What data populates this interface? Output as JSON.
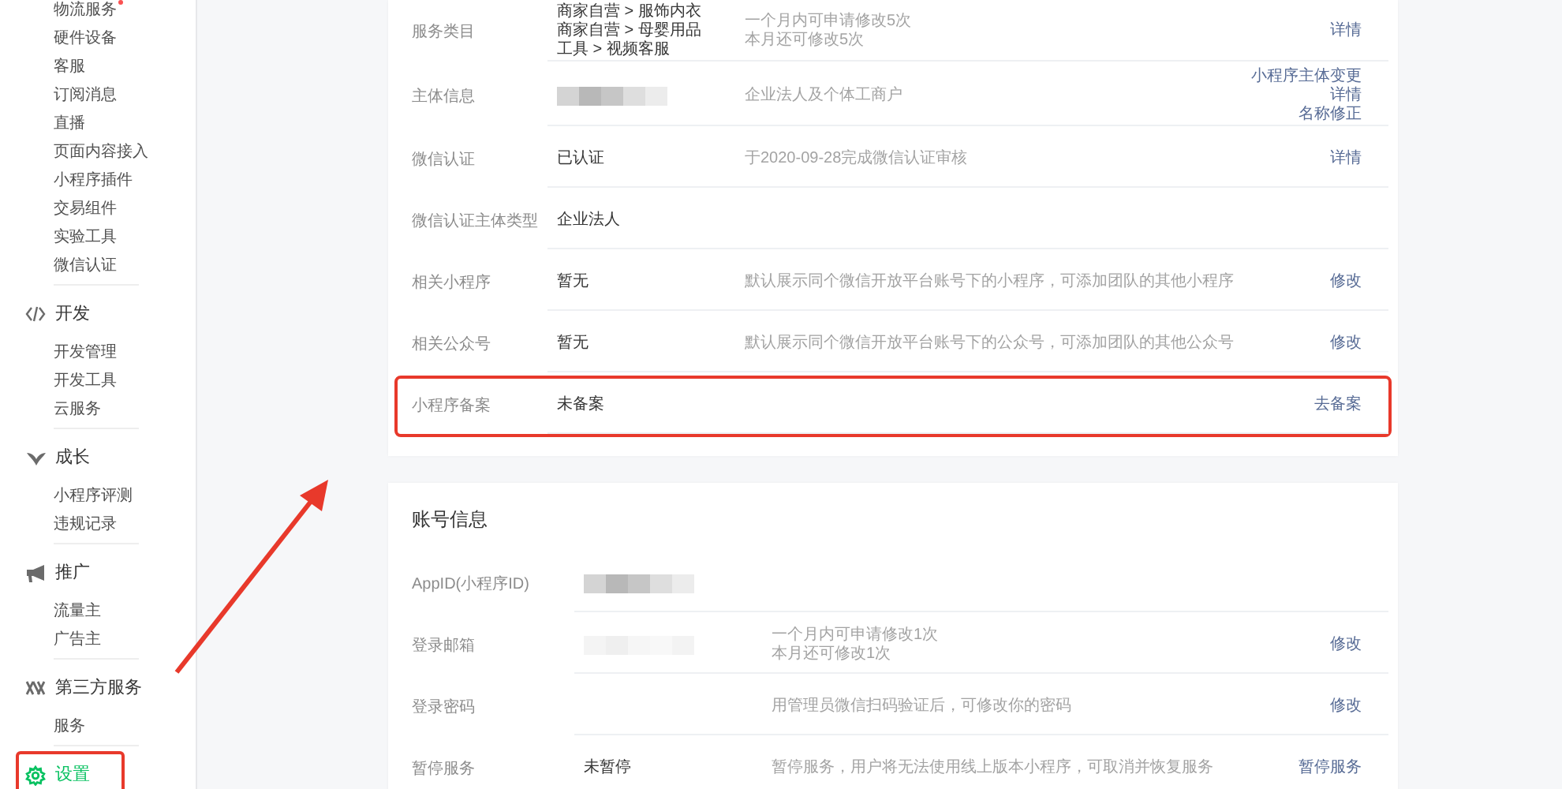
{
  "sidebar": {
    "sections": [
      {
        "items": [
          {
            "label": "物流服务",
            "dot": true,
            "selected": false
          },
          {
            "label": "硬件设备",
            "dot": false,
            "selected": false
          },
          {
            "label": "客服",
            "dot": false,
            "selected": false
          },
          {
            "label": "订阅消息",
            "dot": false,
            "selected": false
          },
          {
            "label": "直播",
            "dot": false,
            "selected": false
          },
          {
            "label": "页面内容接入",
            "dot": false,
            "selected": false
          },
          {
            "label": "小程序插件",
            "dot": false,
            "selected": false
          },
          {
            "label": "交易组件",
            "dot": false,
            "selected": false
          },
          {
            "label": "实验工具",
            "dot": false,
            "selected": false
          },
          {
            "label": "微信认证",
            "dot": false,
            "selected": false
          }
        ]
      },
      {
        "title": "开发",
        "kind": "code",
        "selected": false,
        "highlighted": false,
        "items": [
          {
            "label": "开发管理",
            "dot": false,
            "selected": false
          },
          {
            "label": "开发工具",
            "dot": false,
            "selected": false
          },
          {
            "label": "云服务",
            "dot": false,
            "selected": false
          }
        ]
      },
      {
        "title": "成长",
        "kind": "growth",
        "selected": false,
        "highlighted": false,
        "items": [
          {
            "label": "小程序评测",
            "dot": false,
            "selected": false
          },
          {
            "label": "违规记录",
            "dot": false,
            "selected": false
          }
        ]
      },
      {
        "title": "推广",
        "kind": "promote",
        "selected": false,
        "highlighted": false,
        "items": [
          {
            "label": "流量主",
            "dot": false,
            "selected": false
          },
          {
            "label": "广告主",
            "dot": false,
            "selected": false
          }
        ]
      },
      {
        "title": "第三方服务",
        "kind": "third_party",
        "selected": false,
        "highlighted": false,
        "items": [
          {
            "label": "服务",
            "dot": false,
            "selected": false
          }
        ]
      },
      {
        "title": "设置",
        "kind": "settings",
        "selected": true,
        "highlighted": true
      }
    ]
  },
  "cards": [
    {
      "rows": [
        {
          "label": "服务类目",
          "kind": "text",
          "values": [
            "商家自营 > 服饰内衣",
            "商家自营 > 母婴用品",
            "工具 > 视频客服"
          ],
          "descs": [
            "一个月内可申请修改5次",
            "本月还可修改5次"
          ],
          "actions": [
            "详情"
          ],
          "highlighted": false
        },
        {
          "label": "主体信息",
          "kind": "blurred",
          "descs": [
            "企业法人及个体工商户"
          ],
          "actions": [
            "小程序主体变更",
            "详情",
            "名称修正"
          ],
          "highlighted": false
        },
        {
          "label": "微信认证",
          "kind": "text",
          "values": [
            "已认证"
          ],
          "descs": [
            "于2020-09-28完成微信认证审核"
          ],
          "actions": [
            "详情"
          ],
          "highlighted": false
        },
        {
          "label": "微信认证主体类型",
          "kind": "text",
          "values": [
            "企业法人"
          ],
          "highlighted": false
        },
        {
          "label": "相关小程序",
          "kind": "text",
          "values": [
            "暂无"
          ],
          "descs": [
            "默认展示同个微信开放平台账号下的小程序，可添加团队的其他小程序"
          ],
          "actions": [
            "修改"
          ],
          "highlighted": false
        },
        {
          "label": "相关公众号",
          "kind": "text",
          "values": [
            "暂无"
          ],
          "descs": [
            "默认展示同个微信开放平台账号下的公众号，可添加团队的其他公众号"
          ],
          "actions": [
            "修改"
          ],
          "highlighted": false
        },
        {
          "label": "小程序备案",
          "kind": "text",
          "values": [
            "未备案"
          ],
          "actions": [
            "去备案"
          ],
          "highlighted": true
        }
      ]
    },
    {
      "title": "账号信息",
      "rows": [
        {
          "label": "AppID(小程序ID)",
          "kind": "blurred",
          "highlighted": false
        },
        {
          "label": "登录邮箱",
          "kind": "blurred_faint",
          "descs": [
            "一个月内可申请修改1次",
            "本月还可修改1次"
          ],
          "actions": [
            "修改"
          ],
          "highlighted": false
        },
        {
          "label": "登录密码",
          "kind": "empty",
          "descs": [
            "用管理员微信扫码验证后，可修改你的密码"
          ],
          "actions": [
            "修改"
          ],
          "highlighted": false
        },
        {
          "label": "暂停服务",
          "kind": "text",
          "values": [
            "未暂停"
          ],
          "descs": [
            "暂停服务，用户将无法使用线上版本小程序，可取消并恢复服务"
          ],
          "actions": [
            "暂停服务"
          ],
          "highlighted": false
        }
      ]
    }
  ]
}
